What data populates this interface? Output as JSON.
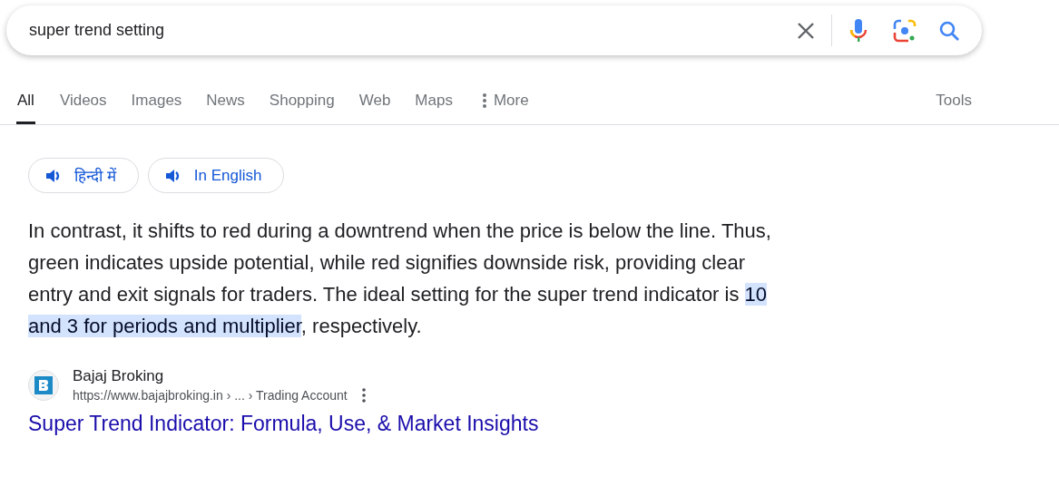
{
  "search": {
    "value": "super trend setting"
  },
  "tabs": [
    {
      "label": "All",
      "selected": true
    },
    {
      "label": "Videos",
      "selected": false
    },
    {
      "label": "Images",
      "selected": false
    },
    {
      "label": "News",
      "selected": false
    },
    {
      "label": "Shopping",
      "selected": false
    },
    {
      "label": "Web",
      "selected": false
    },
    {
      "label": "Maps",
      "selected": false
    }
  ],
  "more_label": "More",
  "tools_label": "Tools",
  "language_buttons": [
    "हिन्दी में",
    "In English"
  ],
  "snippet": {
    "before": "In contrast, it shifts to red during a downtrend when the price is below the line. Thus, green indicates upside potential, while red signifies downside risk, providing clear entry and exit signals for traders. The ideal setting for the super trend indicator is ",
    "highlight": "10 and 3 for periods and multiplier",
    "after": ", respectively."
  },
  "result": {
    "site": "Bajaj Broking",
    "url": "https://www.bajajbroking.in › ... › Trading Account",
    "title": "Super Trend Indicator: Formula, Use, & Market Insights"
  }
}
